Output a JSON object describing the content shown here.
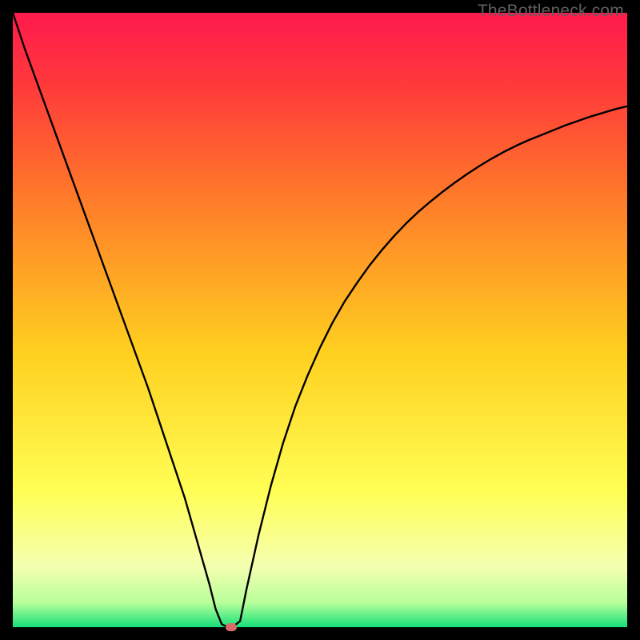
{
  "watermark": "TheBottleneck.com",
  "colors": {
    "top": "#ff1a4d",
    "upper": "#ff6a2a",
    "mid": "#ffd21f",
    "lower_yellow": "#ffff66",
    "pale": "#f6ffb0",
    "green": "#16e07a",
    "curve": "#000000",
    "marker": "#d86a6a",
    "frame": "#000000"
  },
  "chart_data": {
    "type": "line",
    "title": "",
    "xlabel": "",
    "ylabel": "",
    "xlim": [
      0,
      100
    ],
    "ylim": [
      0,
      100
    ],
    "x": [
      0,
      2,
      4,
      6,
      8,
      10,
      12,
      14,
      16,
      18,
      20,
      22,
      24,
      26,
      28,
      30,
      32,
      33,
      34,
      35,
      36,
      37,
      38,
      40,
      42,
      44,
      46,
      48,
      50,
      52,
      54,
      56,
      58,
      60,
      62,
      64,
      66,
      68,
      70,
      72,
      74,
      76,
      78,
      80,
      82,
      84,
      86,
      88,
      90,
      92,
      94,
      96,
      98,
      100
    ],
    "values": [
      100,
      94,
      88.5,
      83,
      77.5,
      72,
      66.5,
      61,
      55.5,
      50,
      44.5,
      39,
      33,
      27,
      21,
      14,
      7,
      3,
      0.5,
      0,
      0.2,
      1,
      6,
      15,
      23,
      30,
      36,
      41,
      45.5,
      49.5,
      53,
      56,
      58.8,
      61.3,
      63.6,
      65.7,
      67.6,
      69.3,
      70.9,
      72.4,
      73.8,
      75.1,
      76.3,
      77.4,
      78.4,
      79.3,
      80.1,
      80.9,
      81.7,
      82.4,
      83.1,
      83.7,
      84.3,
      84.8
    ],
    "gradient_stops": [
      {
        "pct": 0,
        "color": "#ff1a4d"
      },
      {
        "pct": 12,
        "color": "#ff3a3a"
      },
      {
        "pct": 30,
        "color": "#ff7a2a"
      },
      {
        "pct": 55,
        "color": "#ffcf1f"
      },
      {
        "pct": 78,
        "color": "#ffff55"
      },
      {
        "pct": 90,
        "color": "#f6ffb0"
      },
      {
        "pct": 96,
        "color": "#b8ff9a"
      },
      {
        "pct": 100,
        "color": "#16e07a"
      }
    ],
    "marker": {
      "x": 35.5,
      "y": 0
    },
    "grid": false,
    "legend": false
  }
}
